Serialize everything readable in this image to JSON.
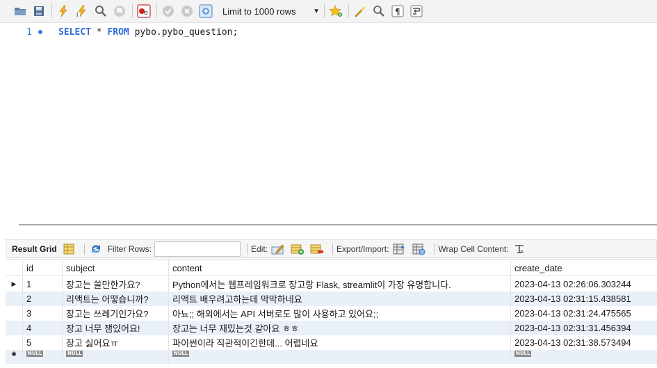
{
  "toolbar": {
    "icons": [
      "open-folder-icon",
      "save-icon",
      "execute-icon",
      "execute-current-icon",
      "explain-icon",
      "stop-icon",
      "toggle-continue-icon",
      "commit-icon",
      "rollback-icon",
      "autocommit-icon",
      "favorite-icon",
      "beautify-icon",
      "find-icon",
      "invisible-chars-icon",
      "wrap-icon"
    ],
    "limit_label": "Limit to 1000 rows"
  },
  "editor": {
    "line_number": "1",
    "keyword_select": "SELECT",
    "star": " * ",
    "keyword_from": "FROM",
    "table": " pybo.pybo_question;"
  },
  "result_toolbar": {
    "tab_label": "Result Grid",
    "filter_label": "Filter Rows:",
    "filter_value": "",
    "edit_label": "Edit:",
    "export_label": "Export/Import:",
    "wrap_label": "Wrap Cell Content:"
  },
  "grid": {
    "columns": [
      "id",
      "subject",
      "content",
      "create_date"
    ],
    "rows": [
      [
        "1",
        "장고는 쓸만한가요?",
        "Python에서는 웹프레임워크로 장고랑 Flask, streamlit이 가장 유명합니다.",
        "2023-04-13 02:26:06.303244"
      ],
      [
        "2",
        "리액트는 어떻습니까?",
        "리액트 배우려고하는데 막막하네요",
        "2023-04-13 02:31:15.438581"
      ],
      [
        "3",
        "장고는 쓰레기인가요?",
        "아뇨;; 해외에서는 API 서버로도 많이 사용하고 있어요;;",
        "2023-04-13 02:31:24.475565"
      ],
      [
        "4",
        "장고 너무 잼있어요!",
        "장고는 너무 재밌는것 같아요 ㅎㅎ",
        "2023-04-13 02:31:31.456394"
      ],
      [
        "5",
        "장고 싫어요ㅠ",
        "파이썬이라 직관적이긴한데... 어렵네요",
        "2023-04-13 02:31:38.573494"
      ]
    ],
    "null_text": "NULL",
    "current_row_marker": "▶",
    "new_row_marker": "✱"
  },
  "colors": {
    "keyword": "#2f6bd8",
    "line_number": "#2b7de1",
    "alt_row": "#e9f0f8"
  }
}
